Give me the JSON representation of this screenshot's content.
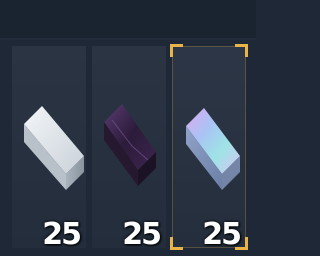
{
  "inventory": {
    "slots": [
      {
        "item": "silver-ingot-icon",
        "count": "25",
        "color": "#d8dfe6",
        "selected": false
      },
      {
        "item": "dark-ingot-icon",
        "count": "25",
        "color": "#3a2448",
        "selected": false
      },
      {
        "item": "iridescent-ingot-icon",
        "count": "25",
        "color": "#b9c6ea",
        "selected": true
      }
    ],
    "accent_color": "#e8b44a"
  }
}
